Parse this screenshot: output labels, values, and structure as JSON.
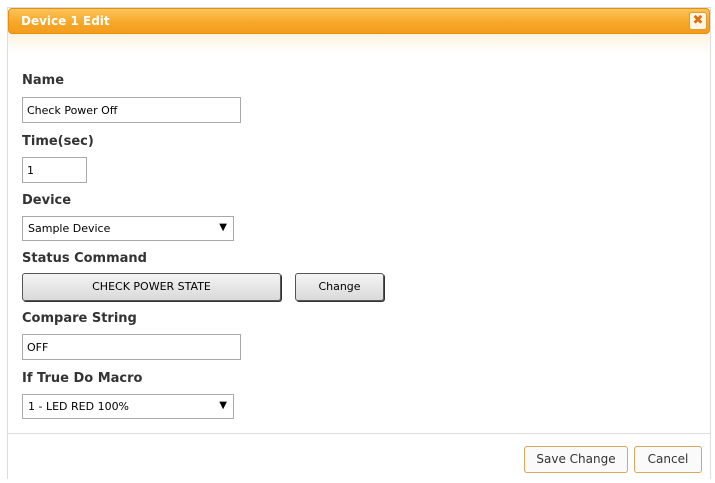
{
  "dialog": {
    "title": "Device 1 Edit",
    "close_glyph": "✖"
  },
  "form": {
    "name_label": "Name",
    "name_value": "Check Power Off",
    "time_label": "Time(sec)",
    "time_value": "1",
    "device_label": "Device",
    "device_selected": "Sample Device",
    "status_command_label": "Status Command",
    "status_command_value": "CHECK POWER STATE",
    "change_button_label": "Change",
    "compare_string_label": "Compare String",
    "compare_string_value": "OFF",
    "macro_label": "If True Do Macro",
    "macro_selected": "1 - LED RED 100%",
    "dropdown_arrow": "▼"
  },
  "footer": {
    "save_label": "Save Change",
    "cancel_label": "Cancel"
  },
  "colors": {
    "titlebar": "#f6a828",
    "titlebar_border": "#e78f08",
    "button_border": "#d8a85a"
  },
  "icons": {
    "close": "close-icon",
    "dropdown": "chevron-down-icon"
  }
}
